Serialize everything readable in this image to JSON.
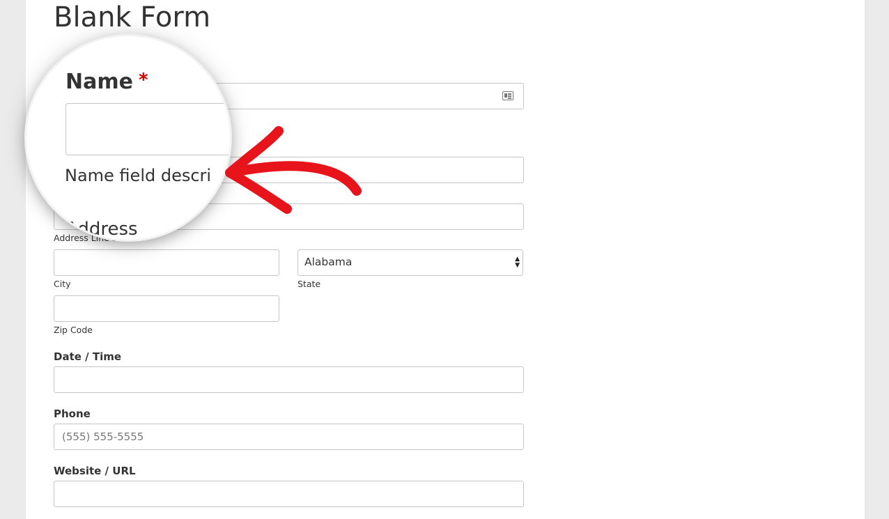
{
  "form": {
    "title": "Blank Form"
  },
  "fields": {
    "address_line2_label": "Address Line 2",
    "city_label": "City",
    "state_label": "State",
    "state_value": "Alabama",
    "zip_label": "Zip Code",
    "datetime_label": "Date / Time",
    "phone_label": "Phone",
    "phone_placeholder": "(555) 555-5555",
    "website_label": "Website / URL"
  },
  "magnified": {
    "name_label": "Name",
    "required_marker": "*",
    "description": "Name field descri"
  },
  "annotation": {
    "arrow_color": "#e8141b"
  },
  "icons": {
    "name_field_icon": "contact-card-icon",
    "state_select_icon": "select-arrows-icon"
  }
}
